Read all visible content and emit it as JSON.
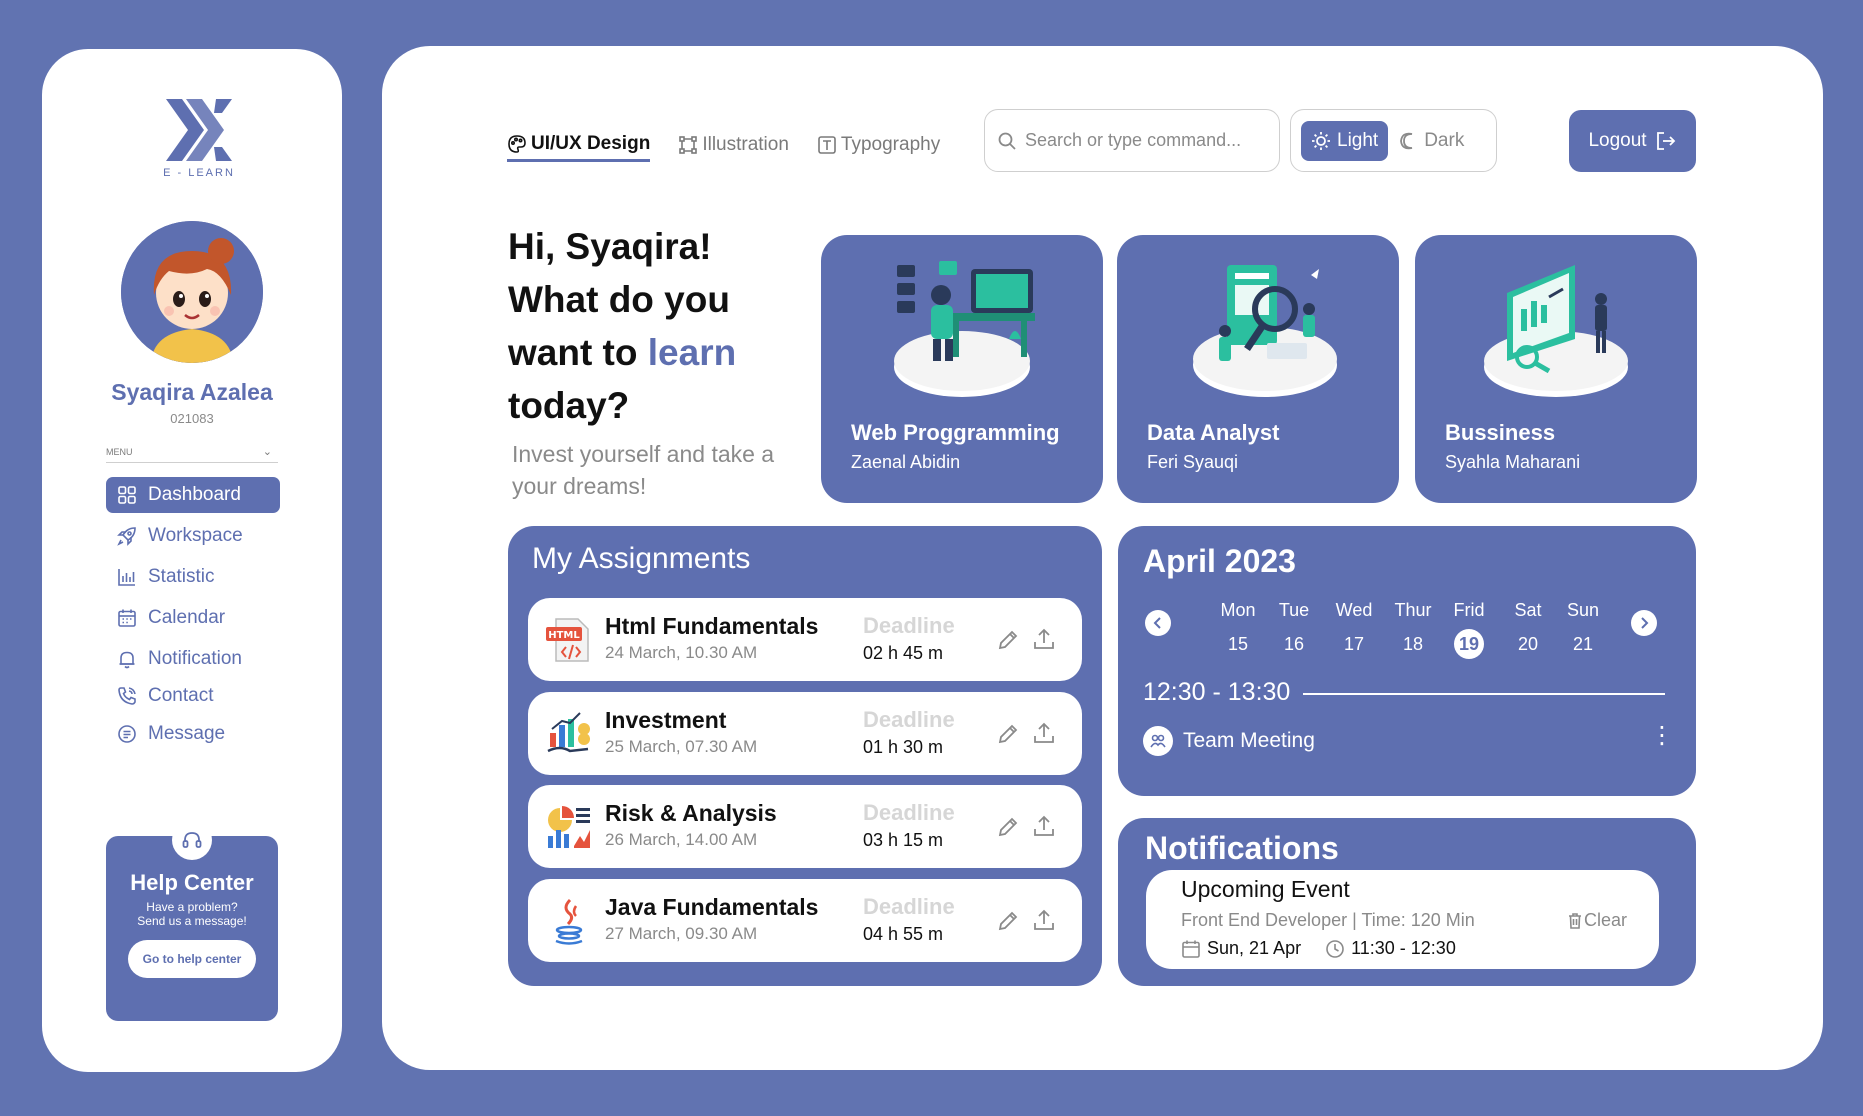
{
  "brand": {
    "name": "E - LEARN"
  },
  "user": {
    "name": "Syaqira Azalea",
    "id": "021083"
  },
  "menu": {
    "heading": "MENU",
    "items": [
      {
        "label": "Dashboard",
        "icon": "dashboard-grid-icon",
        "active": true
      },
      {
        "label": "Workspace",
        "icon": "rocket-icon"
      },
      {
        "label": "Statistic",
        "icon": "bar-chart-icon"
      },
      {
        "label": "Calendar",
        "icon": "calendar-icon"
      },
      {
        "label": "Notification",
        "icon": "bell-icon"
      },
      {
        "label": "Contact",
        "icon": "phone-icon"
      },
      {
        "label": "Message",
        "icon": "message-icon"
      }
    ]
  },
  "help": {
    "title": "Help Center",
    "line1": "Have a problem?",
    "line2": "Send us a message!",
    "button": "Go to help center"
  },
  "topbar": {
    "tabs": [
      {
        "label": "UI/UX Design",
        "icon": "palette-icon",
        "active": true
      },
      {
        "label": "Illustration",
        "icon": "vector-icon"
      },
      {
        "label": "Typography",
        "icon": "text-icon"
      }
    ],
    "search_placeholder": "Search or type command...",
    "theme": {
      "light": "Light",
      "dark": "Dark",
      "selected": "Light"
    },
    "logout": "Logout"
  },
  "hero": {
    "line1": "Hi, Syaqira!",
    "line2": "What do you",
    "line3a": "want to ",
    "line3b": "learn",
    "line4": "today?",
    "subtitle": "Invest yourself and take a your dreams!"
  },
  "courses": [
    {
      "title": "Web Proggramming",
      "instructor": "Zaenal Abidin"
    },
    {
      "title": "Data Analyst",
      "instructor": "Feri Syauqi"
    },
    {
      "title": "Bussiness",
      "instructor": "Syahla Maharani"
    }
  ],
  "assignments": {
    "title": "My Assignments",
    "deadline_label": "Deadline",
    "items": [
      {
        "name": "Html Fundamentals",
        "date": "24 March, 10.30 AM",
        "remaining": "02 h 45 m",
        "icon": "html-file-icon"
      },
      {
        "name": "Investment",
        "date": "25 March, 07.30 AM",
        "remaining": "01 h 30 m",
        "icon": "investment-chart-icon"
      },
      {
        "name": "Risk & Analysis",
        "date": "26 March, 14.00 AM",
        "remaining": "03 h 15 m",
        "icon": "analysis-chart-icon"
      },
      {
        "name": "Java Fundamentals",
        "date": "27 March, 09.30 AM",
        "remaining": "04 h 55 m",
        "icon": "java-icon"
      }
    ]
  },
  "calendar": {
    "month": "April 2023",
    "days": [
      {
        "name": "Mon",
        "num": "15"
      },
      {
        "name": "Tue",
        "num": "16"
      },
      {
        "name": "Wed",
        "num": "17"
      },
      {
        "name": "Thur",
        "num": "18"
      },
      {
        "name": "Frid",
        "num": "19",
        "selected": true
      },
      {
        "name": "Sat",
        "num": "20"
      },
      {
        "name": "Sun",
        "num": "21"
      }
    ],
    "time": "12:30 - 13:30",
    "event": "Team Meeting"
  },
  "notifications": {
    "title": "Notifications",
    "card": {
      "title": "Upcoming Event",
      "subtitle": "Front End Developer | Time: 120 Min",
      "clear": "Clear",
      "date": "Sun, 21 Apr",
      "time": "11:30 - 12:30"
    }
  },
  "colors": {
    "accent": "#5e6fb0",
    "background": "#6173b1",
    "muted": "#8a8a8a"
  }
}
